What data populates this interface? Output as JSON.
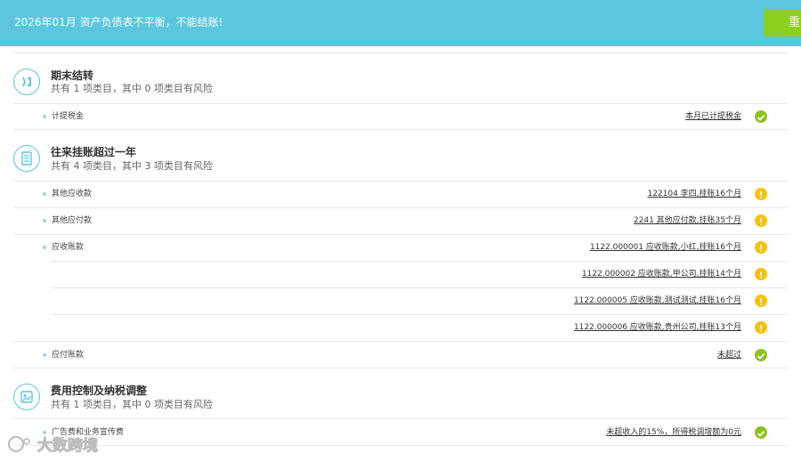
{
  "banner": {
    "message": "2026年01月 资产负债表不平衡，不能结账!",
    "button_label": "重"
  },
  "sections": [
    {
      "icon": "transfer-icon",
      "title": "期末结转",
      "summary": "共有 1 项类目，其中 0 项类目有风险",
      "rows": [
        {
          "label": "计提税金",
          "link": "本月已计提税金",
          "status": "ok"
        }
      ]
    },
    {
      "icon": "ledger-icon",
      "title": "往来挂账超过一年",
      "summary": "共有 4 项类目，其中 3 项类目有风险",
      "rows": [
        {
          "label": "其他应收款",
          "link": "122104 李四,挂账16个月",
          "status": "warning"
        },
        {
          "label": "其他应付款",
          "link": "2241 其他应付款,挂账35个月",
          "status": "warning"
        },
        {
          "label": "应收账款",
          "link": "1122.000001 应收账款,小红,挂账16个月",
          "status": "warning"
        },
        {
          "label": "",
          "link": "1122.000002 应收账款,甲公司,挂账14个月",
          "status": "warning"
        },
        {
          "label": "",
          "link": "1122.000005 应收账款,测试测试,挂账16个月",
          "status": "warning"
        },
        {
          "label": "",
          "link": "1122.000006 应收账款,贵州公司,挂账13个月",
          "status": "warning"
        },
        {
          "label": "应付账款",
          "link": "未超过",
          "status": "ok"
        }
      ]
    },
    {
      "icon": "tax-control-icon",
      "title": "费用控制及纳税调整",
      "summary": "共有 1 项类目，其中 0 项类目有风险",
      "rows": [
        {
          "label": "广告费和业务宣传费",
          "link": "未超收入的15%，所得税调增额为0元",
          "status": "ok"
        }
      ]
    }
  ],
  "watermark": "大数跨境",
  "colors": {
    "banner": "#5bc6de",
    "button": "#8dcf1d",
    "ok": "#8dc21f",
    "warning": "#f5c211"
  }
}
